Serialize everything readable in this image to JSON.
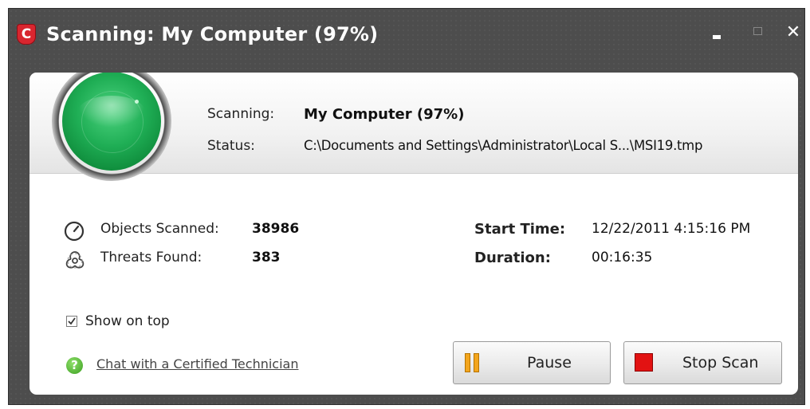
{
  "window": {
    "title": "Scanning: My Computer (97%)",
    "logo_letter": "C"
  },
  "scan": {
    "scanning_label": "Scanning:",
    "scanning_value": "My Computer (97%)",
    "status_label": "Status:",
    "status_value": "C:\\Documents and Settings\\Administrator\\Local S...\\MSI19.tmp"
  },
  "stats": {
    "objects_label": "Objects Scanned:",
    "objects_value": "38986",
    "threats_label": "Threats Found:",
    "threats_value": "383",
    "start_label": "Start Time:",
    "start_value": "12/22/2011 4:15:16 PM",
    "duration_label": "Duration:",
    "duration_value": "00:16:35"
  },
  "options": {
    "show_on_top_label": "Show on top",
    "show_on_top_checked": true
  },
  "help": {
    "chat_link": "Chat with a Certified Technician"
  },
  "buttons": {
    "pause_label": "Pause",
    "stop_label": "Stop Scan"
  },
  "colors": {
    "window_bg": "#4d4d4d",
    "radar_green": "#1fae55",
    "pause_orange": "#f3a51d",
    "stop_red": "#e21212"
  }
}
